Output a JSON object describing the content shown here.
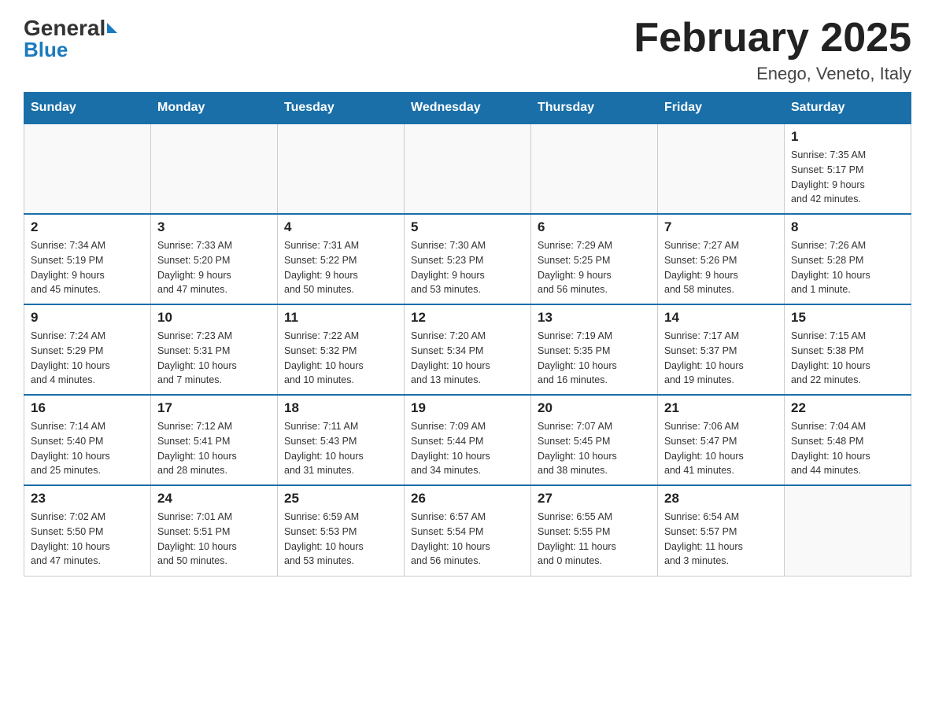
{
  "header": {
    "logo_general": "General",
    "logo_blue": "Blue",
    "month_title": "February 2025",
    "location": "Enego, Veneto, Italy"
  },
  "weekdays": [
    "Sunday",
    "Monday",
    "Tuesday",
    "Wednesday",
    "Thursday",
    "Friday",
    "Saturday"
  ],
  "weeks": [
    [
      {
        "day": "",
        "info": ""
      },
      {
        "day": "",
        "info": ""
      },
      {
        "day": "",
        "info": ""
      },
      {
        "day": "",
        "info": ""
      },
      {
        "day": "",
        "info": ""
      },
      {
        "day": "",
        "info": ""
      },
      {
        "day": "1",
        "info": "Sunrise: 7:35 AM\nSunset: 5:17 PM\nDaylight: 9 hours\nand 42 minutes."
      }
    ],
    [
      {
        "day": "2",
        "info": "Sunrise: 7:34 AM\nSunset: 5:19 PM\nDaylight: 9 hours\nand 45 minutes."
      },
      {
        "day": "3",
        "info": "Sunrise: 7:33 AM\nSunset: 5:20 PM\nDaylight: 9 hours\nand 47 minutes."
      },
      {
        "day": "4",
        "info": "Sunrise: 7:31 AM\nSunset: 5:22 PM\nDaylight: 9 hours\nand 50 minutes."
      },
      {
        "day": "5",
        "info": "Sunrise: 7:30 AM\nSunset: 5:23 PM\nDaylight: 9 hours\nand 53 minutes."
      },
      {
        "day": "6",
        "info": "Sunrise: 7:29 AM\nSunset: 5:25 PM\nDaylight: 9 hours\nand 56 minutes."
      },
      {
        "day": "7",
        "info": "Sunrise: 7:27 AM\nSunset: 5:26 PM\nDaylight: 9 hours\nand 58 minutes."
      },
      {
        "day": "8",
        "info": "Sunrise: 7:26 AM\nSunset: 5:28 PM\nDaylight: 10 hours\nand 1 minute."
      }
    ],
    [
      {
        "day": "9",
        "info": "Sunrise: 7:24 AM\nSunset: 5:29 PM\nDaylight: 10 hours\nand 4 minutes."
      },
      {
        "day": "10",
        "info": "Sunrise: 7:23 AM\nSunset: 5:31 PM\nDaylight: 10 hours\nand 7 minutes."
      },
      {
        "day": "11",
        "info": "Sunrise: 7:22 AM\nSunset: 5:32 PM\nDaylight: 10 hours\nand 10 minutes."
      },
      {
        "day": "12",
        "info": "Sunrise: 7:20 AM\nSunset: 5:34 PM\nDaylight: 10 hours\nand 13 minutes."
      },
      {
        "day": "13",
        "info": "Sunrise: 7:19 AM\nSunset: 5:35 PM\nDaylight: 10 hours\nand 16 minutes."
      },
      {
        "day": "14",
        "info": "Sunrise: 7:17 AM\nSunset: 5:37 PM\nDaylight: 10 hours\nand 19 minutes."
      },
      {
        "day": "15",
        "info": "Sunrise: 7:15 AM\nSunset: 5:38 PM\nDaylight: 10 hours\nand 22 minutes."
      }
    ],
    [
      {
        "day": "16",
        "info": "Sunrise: 7:14 AM\nSunset: 5:40 PM\nDaylight: 10 hours\nand 25 minutes."
      },
      {
        "day": "17",
        "info": "Sunrise: 7:12 AM\nSunset: 5:41 PM\nDaylight: 10 hours\nand 28 minutes."
      },
      {
        "day": "18",
        "info": "Sunrise: 7:11 AM\nSunset: 5:43 PM\nDaylight: 10 hours\nand 31 minutes."
      },
      {
        "day": "19",
        "info": "Sunrise: 7:09 AM\nSunset: 5:44 PM\nDaylight: 10 hours\nand 34 minutes."
      },
      {
        "day": "20",
        "info": "Sunrise: 7:07 AM\nSunset: 5:45 PM\nDaylight: 10 hours\nand 38 minutes."
      },
      {
        "day": "21",
        "info": "Sunrise: 7:06 AM\nSunset: 5:47 PM\nDaylight: 10 hours\nand 41 minutes."
      },
      {
        "day": "22",
        "info": "Sunrise: 7:04 AM\nSunset: 5:48 PM\nDaylight: 10 hours\nand 44 minutes."
      }
    ],
    [
      {
        "day": "23",
        "info": "Sunrise: 7:02 AM\nSunset: 5:50 PM\nDaylight: 10 hours\nand 47 minutes."
      },
      {
        "day": "24",
        "info": "Sunrise: 7:01 AM\nSunset: 5:51 PM\nDaylight: 10 hours\nand 50 minutes."
      },
      {
        "day": "25",
        "info": "Sunrise: 6:59 AM\nSunset: 5:53 PM\nDaylight: 10 hours\nand 53 minutes."
      },
      {
        "day": "26",
        "info": "Sunrise: 6:57 AM\nSunset: 5:54 PM\nDaylight: 10 hours\nand 56 minutes."
      },
      {
        "day": "27",
        "info": "Sunrise: 6:55 AM\nSunset: 5:55 PM\nDaylight: 11 hours\nand 0 minutes."
      },
      {
        "day": "28",
        "info": "Sunrise: 6:54 AM\nSunset: 5:57 PM\nDaylight: 11 hours\nand 3 minutes."
      },
      {
        "day": "",
        "info": ""
      }
    ]
  ]
}
